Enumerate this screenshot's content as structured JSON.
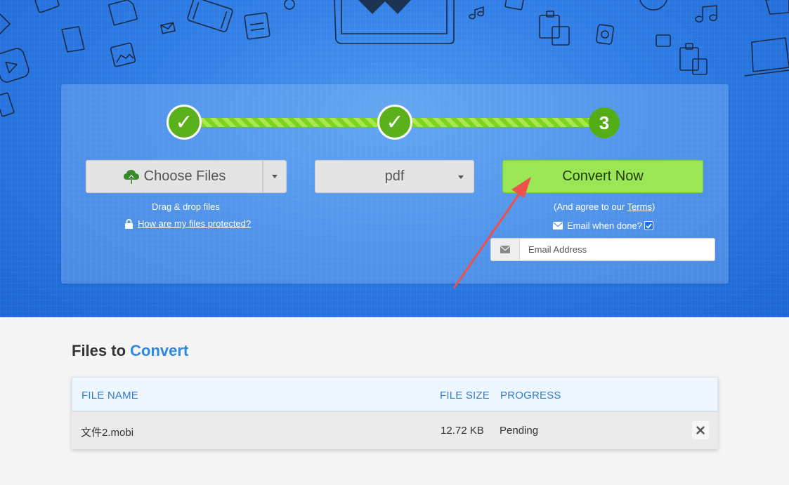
{
  "steps": [
    {
      "state": "done",
      "glyph": "✓"
    },
    {
      "state": "done",
      "glyph": "✓"
    },
    {
      "state": "current",
      "label": "3"
    }
  ],
  "upload": {
    "choose_label": "Choose Files",
    "drag_hint": "Drag & drop files",
    "protected_link": "How are my files protected?"
  },
  "format": {
    "selected": "pdf"
  },
  "convert": {
    "label": "Convert Now",
    "agree_prefix": "(And agree to our ",
    "terms_link": "Terms",
    "agree_suffix": ")",
    "email_when_done": "Email when done?",
    "email_checked": true,
    "email_placeholder": "Email Address"
  },
  "files_section": {
    "title_prefix": "Files to ",
    "title_accent": "Convert",
    "columns": [
      "FILE NAME",
      "FILE SIZE",
      "PROGRESS"
    ],
    "rows": [
      {
        "name": "文件2.mobi",
        "size": "12.72 KB",
        "progress": "Pending"
      }
    ]
  },
  "colors": {
    "accent_green": "#9be655",
    "step_green": "#5ab11b",
    "hero_blue": "#2f7de6",
    "link_blue": "#2f87de"
  }
}
